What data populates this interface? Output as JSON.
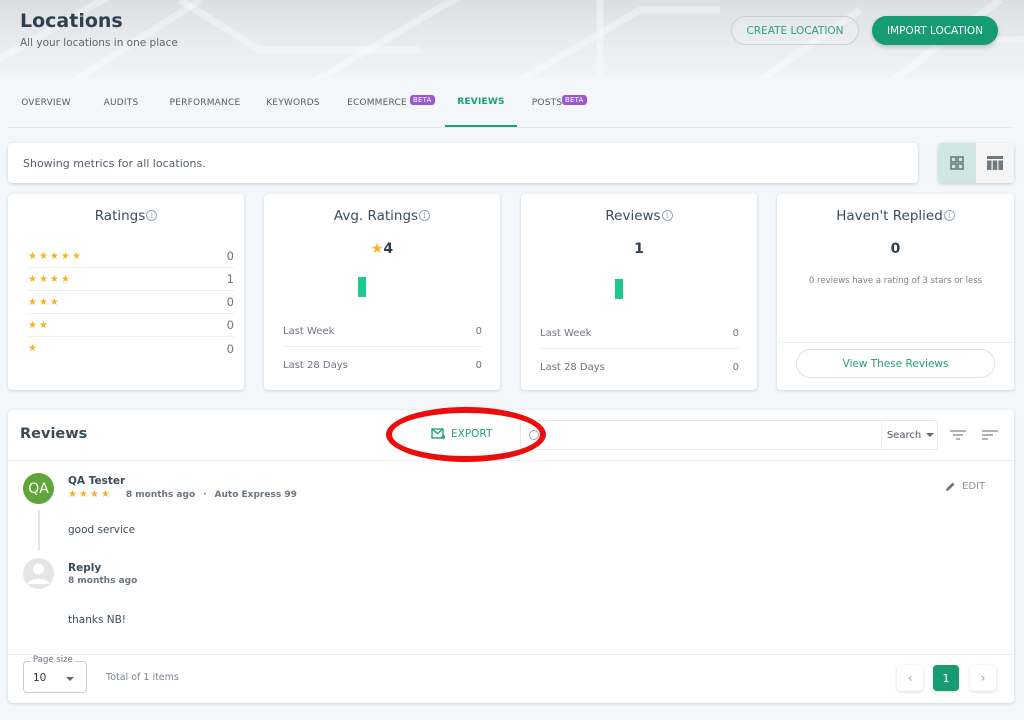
{
  "header": {
    "title": "Locations",
    "subtitle": "All your locations in one place",
    "create_label": "CREATE LOCATION",
    "import_label": "IMPORT LOCATION"
  },
  "tabs": [
    {
      "label": "OVERVIEW",
      "badge": null,
      "active": false
    },
    {
      "label": "AUDITS",
      "badge": null,
      "active": false
    },
    {
      "label": "PERFORMANCE",
      "badge": null,
      "active": false
    },
    {
      "label": "KEYWORDS",
      "badge": null,
      "active": false
    },
    {
      "label": "ECOMMERCE",
      "badge": "BETA",
      "active": false
    },
    {
      "label": "REVIEWS",
      "badge": null,
      "active": true
    },
    {
      "label": "POSTS",
      "badge": "BETA",
      "active": false
    }
  ],
  "metrics_bar": {
    "text": "Showing metrics for all locations.",
    "view_modes": [
      {
        "icon": "grid-icon",
        "active": true
      },
      {
        "icon": "table-icon",
        "active": false
      }
    ]
  },
  "cards": {
    "ratings": {
      "title": "Ratings",
      "rows": [
        {
          "stars": 5,
          "stars_text": "★★★★★",
          "count": "0"
        },
        {
          "stars": 4,
          "stars_text": "★★★★",
          "count": "1"
        },
        {
          "stars": 3,
          "stars_text": "★★★",
          "count": "0"
        },
        {
          "stars": 2,
          "stars_text": "★★",
          "count": "0"
        },
        {
          "stars": 1,
          "stars_text": "★",
          "count": "0"
        }
      ]
    },
    "avg_ratings": {
      "title": "Avg. Ratings",
      "star": "★",
      "value": "4",
      "last_week_label": "Last Week",
      "last_week_value": "0",
      "last_28_label": "Last 28 Days",
      "last_28_value": "0"
    },
    "reviews": {
      "title": "Reviews",
      "value": "1",
      "last_week_label": "Last Week",
      "last_week_value": "0",
      "last_28_label": "Last 28 Days",
      "last_28_value": "0"
    },
    "havent_replied": {
      "title": "Haven't Replied",
      "value": "0",
      "description": "0 reviews have a rating of 3 stars or less",
      "button_label": "View These Reviews"
    }
  },
  "reviews_panel": {
    "title": "Reviews",
    "export_label": "EXPORT",
    "search": {
      "value": "",
      "placeholder": "",
      "scope": "Search"
    },
    "items": [
      {
        "avatar_initials": "QA",
        "reviewer": "QA Tester",
        "rating": 4,
        "stars_text": "★★★★",
        "time": "8 months ago",
        "separator": "·",
        "location": "Auto Express 99",
        "text": "good service",
        "edit_label": "EDIT",
        "reply": {
          "author": "Reply",
          "time": "8 months ago",
          "text": "thanks NB!"
        }
      }
    ],
    "footer": {
      "page_size_label": "Page size",
      "page_size_value": "10",
      "total_text": "Total of 1 items",
      "prev": "‹",
      "current_page": "1",
      "next": "›"
    }
  },
  "colors": {
    "accent": "#179b73",
    "beta_badge": "#9b59d0",
    "star": "#f5b324",
    "spark": "#1dc98e",
    "annotation": "#ee0b0b"
  }
}
